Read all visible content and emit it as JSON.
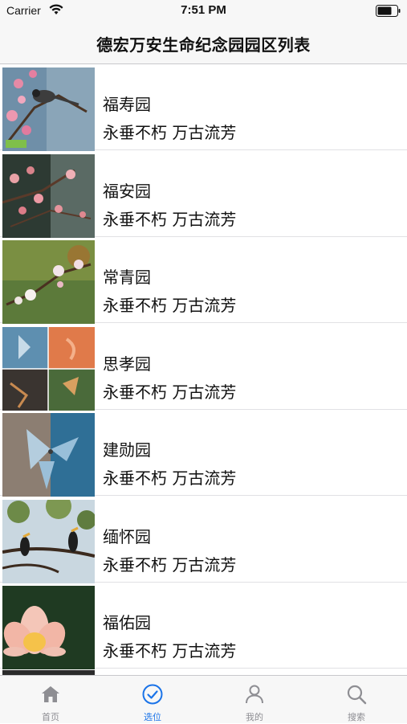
{
  "status_bar": {
    "carrier": "Carrier",
    "time": "7:51 PM"
  },
  "header": {
    "title": "德宏万安生命纪念园园区列表"
  },
  "list": {
    "items": [
      {
        "title": "福寿园",
        "subtitle": "永垂不朽 万古流芳",
        "icon": "bird-on-plum-blossom-image"
      },
      {
        "title": "福安园",
        "subtitle": "永垂不朽 万古流芳",
        "icon": "plum-blossom-image"
      },
      {
        "title": "常青园",
        "subtitle": "永垂不朽 万古流芳",
        "icon": "white-blossom-image"
      },
      {
        "title": "思孝园",
        "subtitle": "永垂不朽 万古流芳",
        "icon": "butterfly-collage-image"
      },
      {
        "title": "建勋园",
        "subtitle": "永垂不朽 万古流芳",
        "icon": "crystal-butterfly-image"
      },
      {
        "title": "缅怀园",
        "subtitle": "永垂不朽 万古流芳",
        "icon": "hornbill-birds-image"
      },
      {
        "title": "福佑园",
        "subtitle": "永垂不朽 万古流芳",
        "icon": "lotus-flower-image"
      }
    ]
  },
  "tab_bar": {
    "tabs": [
      {
        "label": "首页",
        "icon": "home-icon",
        "active": false
      },
      {
        "label": "选位",
        "icon": "checkmark-circle-icon",
        "active": true
      },
      {
        "label": "我的",
        "icon": "person-icon",
        "active": false
      },
      {
        "label": "搜索",
        "icon": "search-icon",
        "active": false
      }
    ]
  },
  "colors": {
    "accent": "#1a73e8",
    "inactive": "#8e8e93",
    "bar_background": "#f7f7f7"
  }
}
